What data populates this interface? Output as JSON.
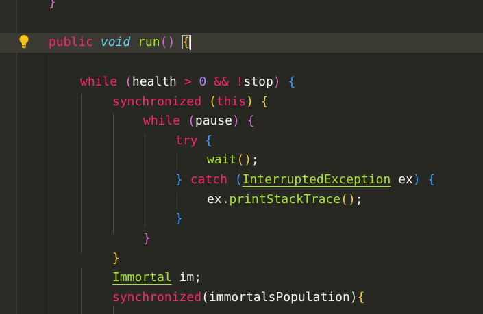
{
  "editor": {
    "colors": {
      "background": "#272822",
      "current_line": "#3a3a33",
      "keyword": "#f92672",
      "type": "#66d9ef",
      "function": "#a6e22e",
      "number": "#ae81ff",
      "bracket_gold": "#f7c948",
      "bracket_orchid": "#da70d6",
      "bracket_blue": "#3b9cff"
    },
    "icons": {
      "lightbulb": "lightbulb-icon"
    },
    "lines": {
      "l0": {
        "brace": "}"
      },
      "l1": {
        "kw_public": "public",
        "kw_void": "void",
        "fn_run": "run",
        "paren_open": "(",
        "paren_close": ")",
        "brace_open": "{"
      },
      "l3": {
        "kw_while": "while",
        "paren_open": "(",
        "id_health": "health",
        "op_gt": ">",
        "num_zero": "0",
        "op_and": "&&",
        "op_not": "!",
        "id_stop": "stop",
        "paren_close": ")",
        "brace_open": "{"
      },
      "l4": {
        "kw_sync": "synchronized",
        "paren_open": "(",
        "kw_this": "this",
        "paren_close": ")",
        "brace_open": "{"
      },
      "l5": {
        "kw_while": "while",
        "paren_open": "(",
        "id_pause": "pause",
        "paren_close": ")",
        "brace_open": "{"
      },
      "l6": {
        "kw_try": "try",
        "brace_open": "{"
      },
      "l7": {
        "fn_wait": "wait",
        "paren_open": "(",
        "paren_close": ")",
        "semi": ";"
      },
      "l8": {
        "brace_close": "}",
        "kw_catch": "catch",
        "paren_open": "(",
        "cls_exc": "InterruptedException",
        "id_ex": "ex",
        "paren_close": ")",
        "brace_open": "{"
      },
      "l9": {
        "id_ex": "ex",
        "dot": ".",
        "fn_print": "printStackTrace",
        "paren_open": "(",
        "paren_close": ")",
        "semi": ";"
      },
      "l10": {
        "brace_close": "}"
      },
      "l11": {
        "brace_close": "}"
      },
      "l12": {
        "brace_close": "}"
      },
      "l13": {
        "cls_immortal": "Immortal",
        "id_im": "im",
        "semi": ";"
      },
      "l14": {
        "kw_sync": "synchronized",
        "paren_open": "(",
        "id_pop": "immortalsPopulation",
        "paren_close": ")",
        "brace_open": "{"
      }
    }
  }
}
